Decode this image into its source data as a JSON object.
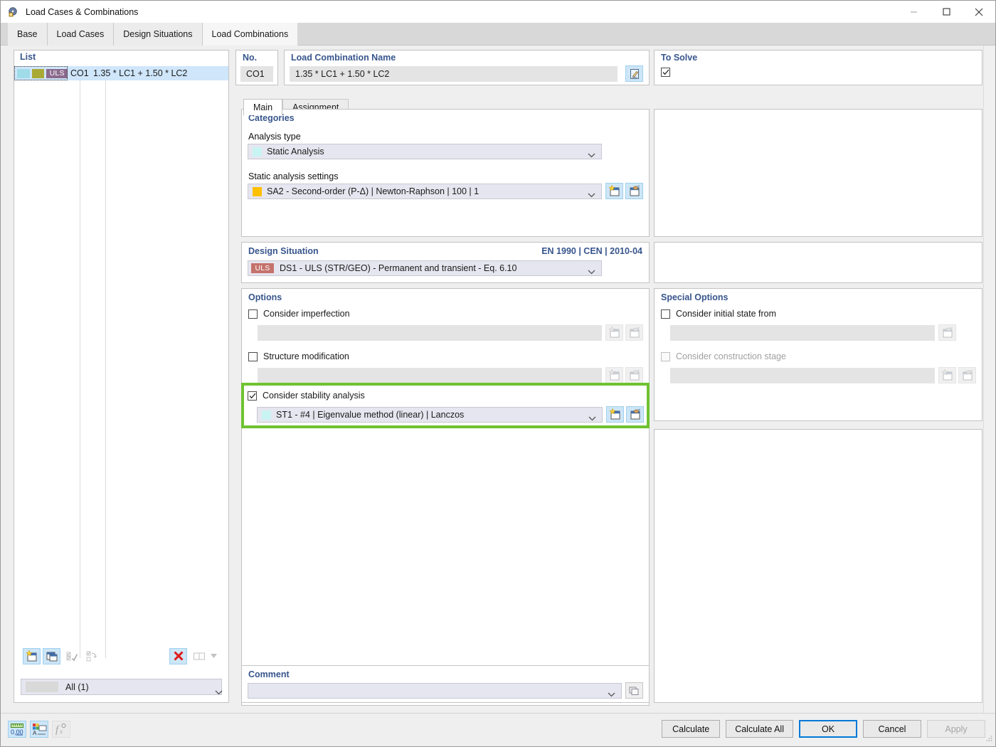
{
  "window": {
    "title": "Load Cases & Combinations",
    "icon": "app-icon",
    "minimize": "—",
    "maximize": "□",
    "close": "✕"
  },
  "tabs": [
    {
      "label": "Base",
      "active": false
    },
    {
      "label": "Load Cases",
      "active": false
    },
    {
      "label": "Design Situations",
      "active": false
    },
    {
      "label": "Load Combinations",
      "active": true
    }
  ],
  "list": {
    "header": "List",
    "rows": [
      {
        "swatch1": "#9fdbe8",
        "swatch2": "#a9aa36",
        "badge": "ULS",
        "badge_color": "#8b6a8d",
        "no": "CO1",
        "expression": "1.35 * LC1 + 1.50 * LC2"
      }
    ],
    "toolbar": [
      {
        "name": "new-item-button",
        "enabled": true
      },
      {
        "name": "copy-item-button",
        "enabled": true
      },
      {
        "name": "select-all-button",
        "enabled": false
      },
      {
        "name": "invert-selection-button",
        "enabled": false
      },
      {
        "name": "delete-item-button",
        "enabled": true
      },
      {
        "name": "view-layout-button",
        "enabled": false
      }
    ],
    "filter": {
      "value": "All (1)",
      "swatch": "#d9d9d9"
    }
  },
  "header_fields": {
    "no_label": "No.",
    "no_value": "CO1",
    "name_label": "Load Combination Name",
    "name_value": "1.35 * LC1 + 1.50 * LC2",
    "name_edit_button": "edit-formula-button",
    "to_solve_label": "To Solve",
    "to_solve_checked": true
  },
  "inner_tabs": [
    {
      "label": "Main",
      "active": true
    },
    {
      "label": "Assignment",
      "active": false
    }
  ],
  "categories": {
    "title": "Categories",
    "analysis_type_label": "Analysis type",
    "analysis_type_value": "Static Analysis",
    "analysis_type_swatch": "#c9f4f4",
    "static_settings_label": "Static analysis settings",
    "static_settings_value": "SA2 - Second-order (P-Δ) | Newton-Raphson | 100 | 1",
    "static_settings_swatch": "#ffc000",
    "new_button": "new-static-analysis-button",
    "edit_button": "edit-static-analysis-button"
  },
  "design_situation": {
    "title": "Design Situation",
    "standard": "EN 1990 | CEN | 2010-04",
    "badge": "ULS",
    "badge_color": "#c5726c",
    "value": "DS1 - ULS (STR/GEO) - Permanent and transient - Eq. 6.10"
  },
  "options": {
    "title": "Options",
    "imperfection": {
      "label": "Consider imperfection",
      "checked": false,
      "value": "",
      "new_button": "new-imperfection-button",
      "edit_button": "edit-imperfection-button"
    },
    "structure_modification": {
      "label": "Structure modification",
      "checked": false,
      "value": "",
      "new_button": "new-structure-modification-button",
      "edit_button": "edit-structure-modification-button"
    },
    "stability_analysis": {
      "label": "Consider stability analysis",
      "checked": true,
      "value": "ST1 - #4 | Eigenvalue method (linear) | Lanczos",
      "swatch": "#c9f4f4",
      "new_button": "new-stability-analysis-button",
      "edit_button": "edit-stability-analysis-button",
      "highlight_color": "#6fc230"
    }
  },
  "special_options": {
    "title": "Special Options",
    "initial_state": {
      "label": "Consider initial state from",
      "checked": false,
      "value": "",
      "edit_button": "edit-initial-state-button"
    },
    "construction_stage": {
      "label": "Consider construction stage",
      "checked": false,
      "disabled": true,
      "value": "",
      "new_button": "new-construction-stage-button",
      "edit_button": "edit-construction-stage-button"
    }
  },
  "comment": {
    "title": "Comment",
    "value": "",
    "button": "comment-library-button"
  },
  "footer": {
    "tools": [
      {
        "name": "units-decimal-places-button",
        "enabled": true
      },
      {
        "name": "display-properties-button",
        "enabled": true
      },
      {
        "name": "formula-editor-button",
        "enabled": false
      }
    ],
    "buttons": [
      {
        "label": "Calculate",
        "style": "normal",
        "name": "calculate-button"
      },
      {
        "label": "Calculate All",
        "style": "normal",
        "name": "calculate-all-button"
      },
      {
        "label": "OK",
        "style": "primary",
        "name": "ok-button"
      },
      {
        "label": "Cancel",
        "style": "normal",
        "name": "cancel-button"
      },
      {
        "label": "Apply",
        "style": "disabled",
        "name": "apply-button"
      }
    ]
  }
}
